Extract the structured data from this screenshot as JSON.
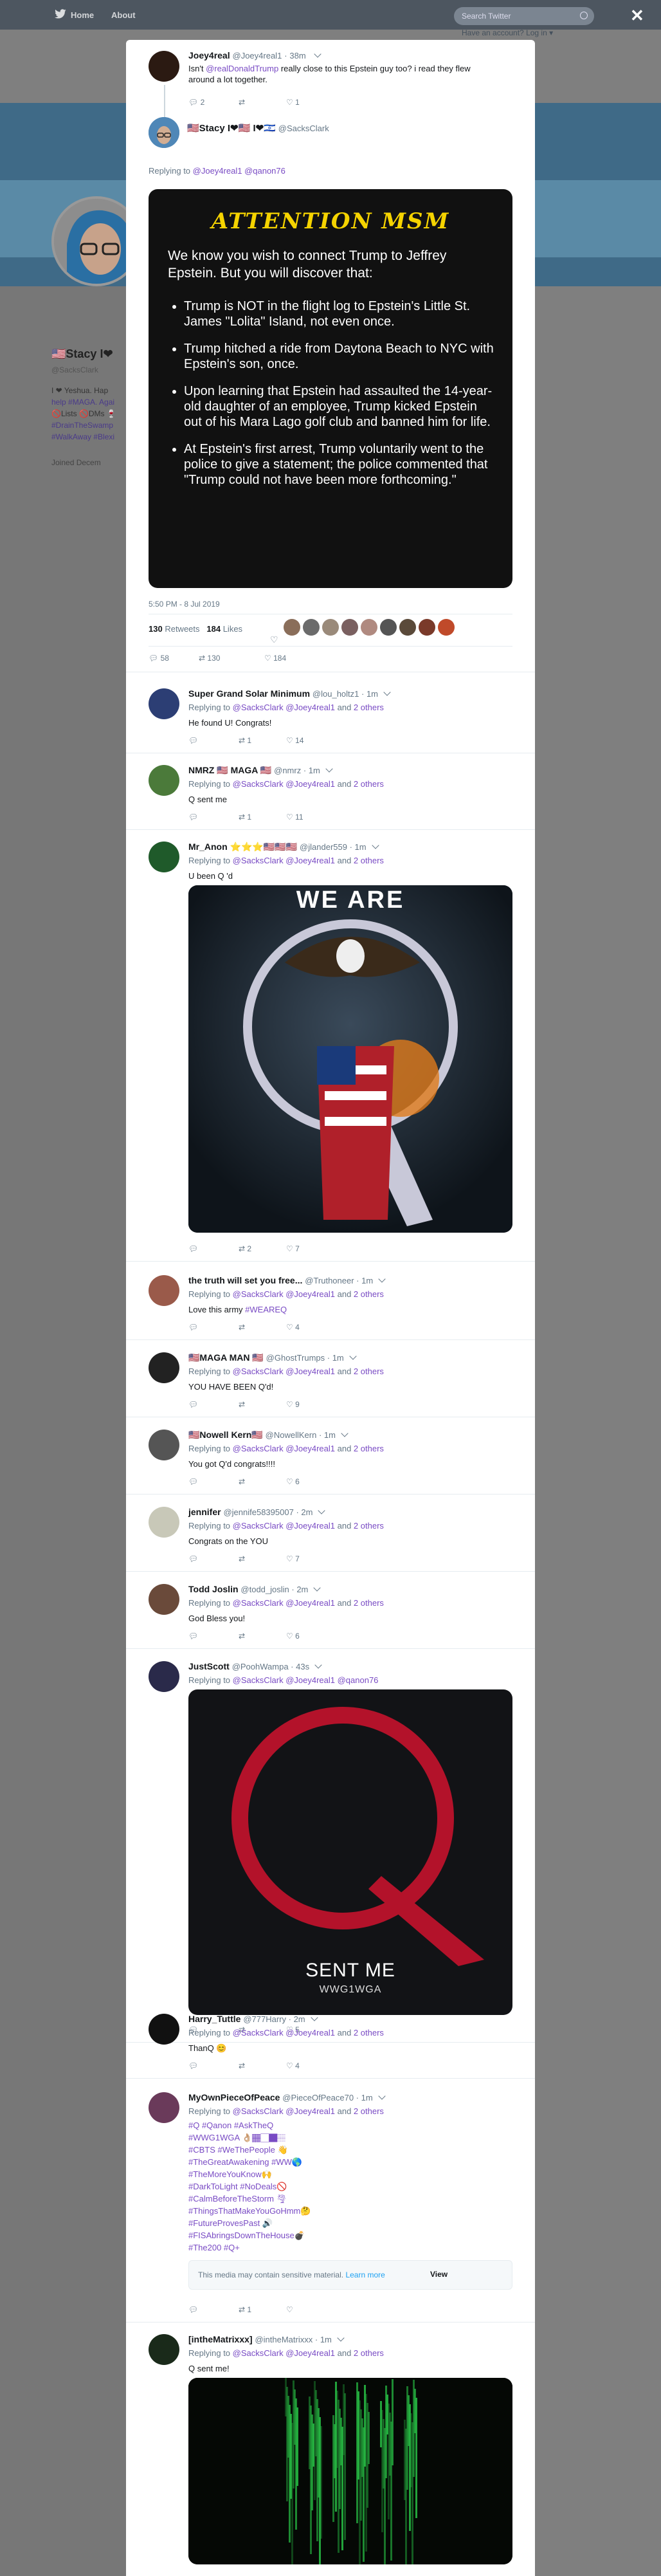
{
  "nav": {
    "home": "Home",
    "about": "About",
    "search_placeholder": "Search Twitter",
    "login": "Have an account? Log in ▾",
    "close": "✕"
  },
  "background": {
    "name": "🇺🇸Stacy I❤",
    "handle": "@SacksClark",
    "bio1": "I ❤ Yeshua. Hap",
    "bio2": "help #MAGA. Agai",
    "bio3": "🚫Lists 🚫DMs 🍷",
    "bio4": "#DrainTheSwamp",
    "bio5": "#WalkAway #Blexi",
    "joined": "Joined Decem"
  },
  "parent": {
    "name": "Joey4real",
    "handle": "@Joey4real1",
    "time": "38m",
    "text_a": "Isn't ",
    "text_link": "@realDonaldTrump",
    "text_b": " really close to this Epstein guy too? i read they flew",
    "text_c": "around a lot together.",
    "replies": "2",
    "likes": "1"
  },
  "main": {
    "name": "🇺🇸Stacy I❤🇺🇸 I❤🇮🇱",
    "handle": "@SacksClark",
    "replying_label": "Replying to ",
    "replying_1": "@Joey4real1",
    "replying_2": " @qanon76",
    "card": {
      "title": "ATTENTION MSM",
      "intro": "We know you wish to connect Trump to Jeffrey Epstein.  But you will discover that:",
      "bullets": [
        "Trump is NOT in the flight log to Epstein's Little St. James \"Lolita\" Island, not even once.",
        "Trump hitched a ride from Daytona Beach to NYC with Epstein's son, once.",
        "Upon learning that Epstein had assaulted the 14-year-old daughter of an employee, Trump kicked Epstein out of his Mara Lago golf club and banned him for life.",
        "At Epstein's first arrest, Trump voluntarily went to the police to give a statement; the police commented that \"Trump could not  have been more forthcoming.\""
      ]
    },
    "timestamp": "5:50 PM - 8 Jul 2019",
    "retweets_n": "130",
    "retweets_label": "Retweets",
    "likes_n": "184",
    "likes_label": "Likes",
    "replies": "58",
    "rts": "130",
    "lk": "184"
  },
  "replies": [
    {
      "name": "Super Grand Solar Minimum",
      "handle": "@lou_holtz1",
      "time": "1m",
      "mentions": "@SacksClark @Joey4real1",
      "others": "2 others",
      "text": "He found U! Congrats!",
      "rt": "1",
      "likes": "14"
    },
    {
      "name": "NMRZ 🇺🇸 MAGA 🇺🇸",
      "handle": "@nmrz",
      "time": "1m",
      "mentions": "@SacksClark @Joey4real1",
      "others": "2 others",
      "text": "Q sent me",
      "rt": "1",
      "likes": "11"
    },
    {
      "name": "Mr_Anon ⭐⭐⭐🇺🇸🇺🇸🇺🇸",
      "handle": "@jlander559",
      "time": "1m",
      "mentions": "@SacksClark @Joey4real1",
      "others": "2 others",
      "text": "U been Q 'd",
      "rt": "2",
      "likes": "7",
      "image_text": "WE ARE"
    },
    {
      "name": "the truth will set you free...",
      "handle": "@Truthoneer",
      "time": "1m",
      "mentions": "@SacksClark @Joey4real1",
      "others": "2 others",
      "text_a": "Love this army ",
      "text_link": "#WEAREQ",
      "rt": "",
      "likes": "4"
    },
    {
      "name": "🇺🇸MAGA MAN 🇺🇸",
      "handle": "@GhostTrumps",
      "time": "1m",
      "mentions": "@SacksClark @Joey4real1",
      "others": "2 others",
      "text": "YOU HAVE BEEN Q'd!",
      "rt": "",
      "likes": "9"
    },
    {
      "name": "🇺🇸Nowell Kern🇺🇸",
      "handle": "@NowellKern",
      "time": "1m",
      "mentions": "@SacksClark @Joey4real1",
      "others": "2 others",
      "text": "You got Q'd congrats!!!!",
      "rt": "",
      "likes": "6"
    },
    {
      "name": "jennifer",
      "handle": "@jennife58395007",
      "time": "2m",
      "mentions": "@SacksClark @Joey4real1",
      "others": "2 others",
      "text": "Congrats on the YOU",
      "rt": "",
      "likes": "7"
    },
    {
      "name": "Todd Joslin",
      "handle": "@todd_joslin",
      "time": "2m",
      "mentions": "@SacksClark @Joey4real1",
      "others": "2 others",
      "text": "God Bless you!",
      "rt": "",
      "likes": "6"
    },
    {
      "name": "JustScott",
      "handle": "@PoohWampa",
      "time": "43s",
      "mentions": "@SacksClark @Joey4real1 @qanon76",
      "image_title": "SENT ME",
      "image_sub": "WWG1WGA",
      "rt": "",
      "likes": "5"
    },
    {
      "name": "Harry_Tuttle",
      "handle": "@777Harry",
      "time": "2m",
      "mentions": "@SacksClark @Joey4real1",
      "others": "2 others",
      "text": "ThanQ 😊",
      "rt": "",
      "likes": "4"
    },
    {
      "name": "MyOwnPieceOfPeace",
      "handle": "@PieceOfPeace70",
      "time": "1m",
      "mentions": "@SacksClark @Joey4real1",
      "others": "2 others",
      "tags": [
        "#Q #Qanon #AskTheQ",
        "#WWG1WGA 👌🏼🏾🏻🏿🏽",
        "#CBTS #WeThePeople 👋",
        "#TheGreatAwakening #WW🌎",
        "#TheMoreYouKnow🙌",
        "#DarkToLight #NoDeals🚫",
        "#CalmBeforeTheStorm 🌪",
        "#ThingsThatMakeYouGoHmm🤔",
        "#FutureProvesPast 🔊",
        "#FISAbringsDownTheHouse💣",
        "#The200 #Q+"
      ],
      "sensitive": "This media may contain sensitive material.",
      "learn_more": "Learn more",
      "view": "View",
      "rt": "1",
      "likes": ""
    },
    {
      "name": "[intheMatrixxx]",
      "handle": "@intheMatrixxx",
      "time": "1m",
      "mentions": "@SacksClark @Joey4real1",
      "others": "2 others",
      "text": "Q sent me!"
    }
  ],
  "common": {
    "replying_to": "Replying to ",
    "and": " and "
  },
  "colors": {
    "link": "#1da1f2",
    "mention": "#794bc4",
    "card_bg": "#111111",
    "card_title": "#f5d300",
    "q_red": "#b3122a"
  }
}
